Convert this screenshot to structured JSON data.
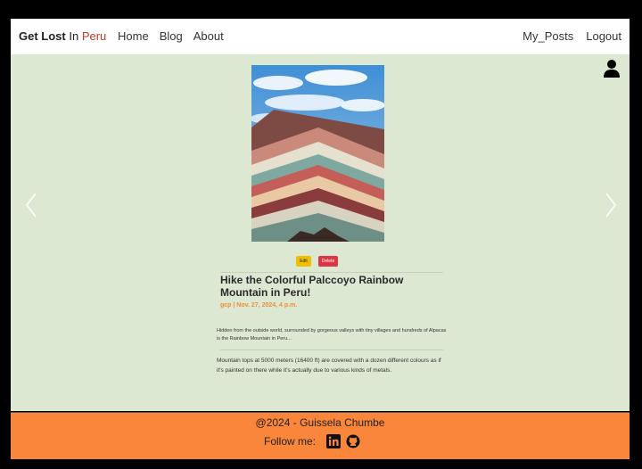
{
  "navbar": {
    "brand": {
      "part1": "Get Lost",
      "part2": "In",
      "part3": "Peru"
    },
    "links": [
      {
        "label": "Home"
      },
      {
        "label": "Blog"
      },
      {
        "label": "About"
      }
    ],
    "right_links": [
      {
        "label": "My_Posts"
      },
      {
        "label": "Logout"
      }
    ]
  },
  "post": {
    "image_icon": "mountain-photo",
    "edit_label": "Edit",
    "delete_label": "Delete",
    "title": "Hike the Colorful Palccoyo Rainbow Mountain in Peru!",
    "meta": "gcp | Nov. 27, 2024, 4 p.m.",
    "summary": "Hidden from the outside world, surrounded by gorgeous valleys with tiny villages and hundreds of Alpacas is the Rainbow Mountain in Peru...",
    "body": "Mountain tops at 5000 meters (16400 ft) are covered with a dozen different colours as if it's painted on there while it's actually due to various kinds of metals."
  },
  "footer": {
    "copyright": "@2024 - Guissela Chumbe",
    "follow_label": "Follow me:",
    "social_icons": [
      "linkedin-icon",
      "github-icon"
    ]
  },
  "colors": {
    "background": "#dde8d3",
    "footer": "#f9863a",
    "brand_accent": "#c0392b",
    "meta": "#e8913a",
    "edit_button": "#f0c000",
    "delete_button": "#dc3545"
  }
}
